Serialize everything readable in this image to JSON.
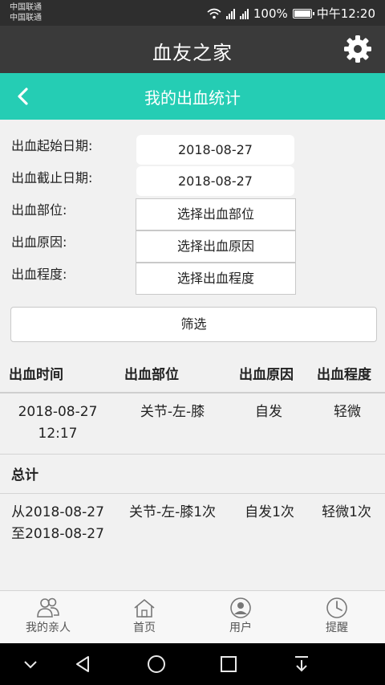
{
  "status_bar": {
    "carrier_1": "中国联通",
    "carrier_2": "中国联通",
    "battery": "100%",
    "time": "中午12:20"
  },
  "header": {
    "app_title": "血友之家",
    "settings_icon": "gear-icon"
  },
  "page": {
    "title": "我的出血统计",
    "back_icon": "chevron-left-icon"
  },
  "form": {
    "start_date_label": "出血起始日期:",
    "start_date_value": "2018-08-27",
    "end_date_label": "出血截止日期:",
    "end_date_value": "2018-08-27",
    "location_label": "出血部位:",
    "location_select": "选择出血部位",
    "cause_label": "出血原因:",
    "cause_select": "选择出血原因",
    "severity_label": "出血程度:",
    "severity_select": "选择出血程度",
    "filter_button": "筛选"
  },
  "table": {
    "headers": [
      "出血时间",
      "出血部位",
      "出血原因",
      "出血程度"
    ],
    "rows": [
      {
        "time_date": "2018-08-27",
        "time_clock": "12:17",
        "location": "关节-左-膝",
        "cause": "自发",
        "severity": "轻微"
      }
    ],
    "total_label": "总计",
    "total": {
      "range_from": "从2018-08-27",
      "range_to": "至2018-08-27",
      "location": "关节-左-膝1次",
      "cause": "自发1次",
      "severity": "轻微1次"
    }
  },
  "bottom_nav": [
    {
      "label": "我的亲人",
      "icon": "family-icon"
    },
    {
      "label": "首页",
      "icon": "home-icon"
    },
    {
      "label": "用户",
      "icon": "user-icon"
    },
    {
      "label": "提醒",
      "icon": "clock-icon"
    }
  ],
  "colors": {
    "accent": "#25cdb4",
    "header_bg": "#3a3a3a",
    "status_bg": "#2e2e2e"
  }
}
